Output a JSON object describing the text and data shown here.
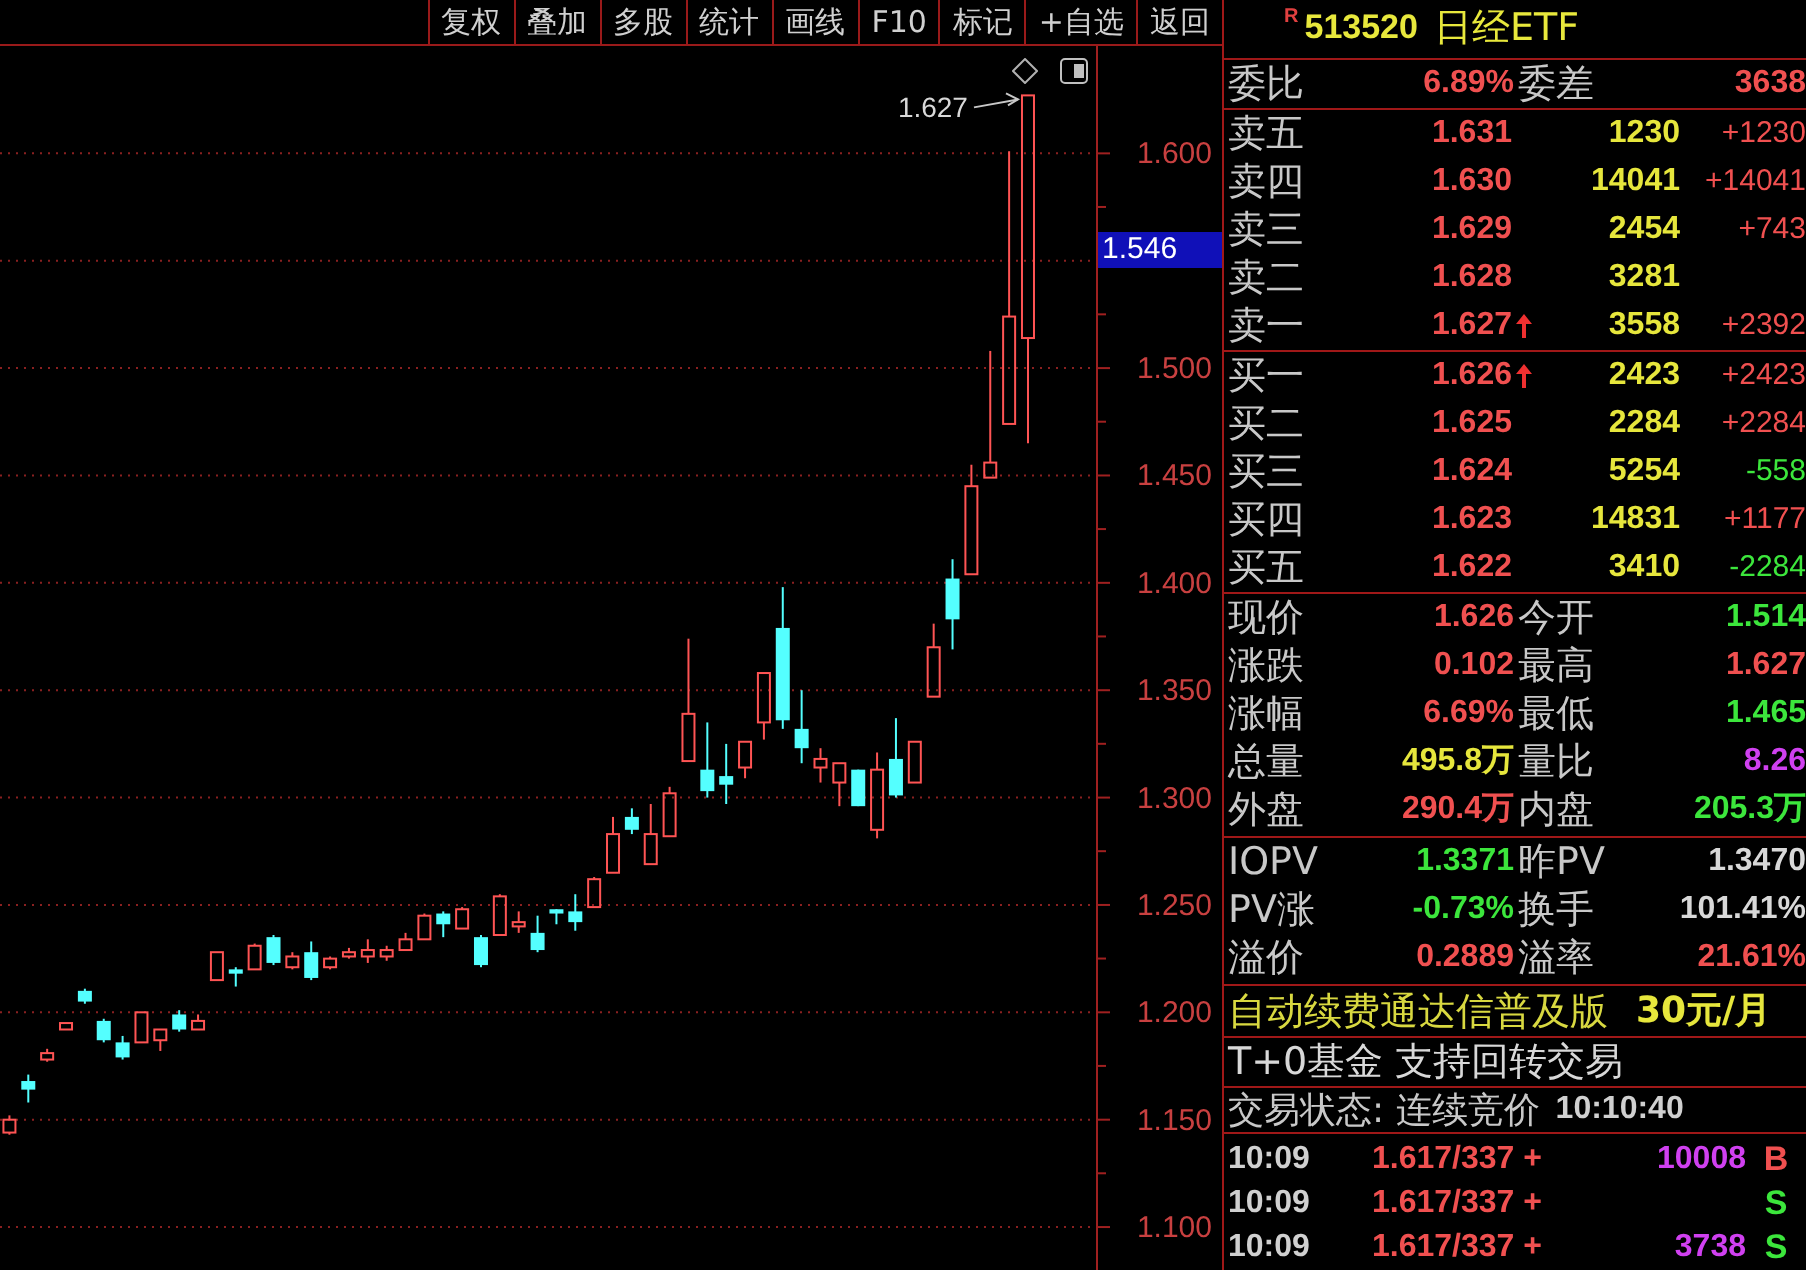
{
  "toolbar": {
    "buttons": [
      "复权",
      "叠加",
      "多股",
      "统计",
      "画线",
      "F10",
      "标记",
      "+自选",
      "返回"
    ]
  },
  "chart": {
    "price_tag": "1.546",
    "chart_data": {
      "type": "candlestick",
      "ohlc": [
        [
          1.144,
          1.152,
          1.143,
          1.15
        ],
        [
          1.168,
          1.171,
          1.158,
          1.164
        ],
        [
          1.178,
          1.183,
          1.177,
          1.181
        ],
        [
          1.192,
          1.195,
          1.192,
          1.195
        ],
        [
          1.21,
          1.211,
          1.204,
          1.205
        ],
        [
          1.196,
          1.197,
          1.186,
          1.187
        ],
        [
          1.186,
          1.189,
          1.178,
          1.179
        ],
        [
          1.186,
          1.2,
          1.186,
          1.2
        ],
        [
          1.187,
          1.192,
          1.182,
          1.192
        ],
        [
          1.199,
          1.201,
          1.191,
          1.192
        ],
        [
          1.192,
          1.199,
          1.192,
          1.196
        ],
        [
          1.215,
          1.228,
          1.215,
          1.228
        ],
        [
          1.22,
          1.221,
          1.212,
          1.218
        ],
        [
          1.22,
          1.232,
          1.22,
          1.231
        ],
        [
          1.235,
          1.236,
          1.222,
          1.223
        ],
        [
          1.221,
          1.228,
          1.22,
          1.226
        ],
        [
          1.228,
          1.233,
          1.215,
          1.216
        ],
        [
          1.221,
          1.226,
          1.22,
          1.225
        ],
        [
          1.226,
          1.23,
          1.225,
          1.228
        ],
        [
          1.226,
          1.234,
          1.223,
          1.229
        ],
        [
          1.226,
          1.231,
          1.224,
          1.229
        ],
        [
          1.229,
          1.237,
          1.229,
          1.234
        ],
        [
          1.234,
          1.246,
          1.234,
          1.245
        ],
        [
          1.246,
          1.247,
          1.235,
          1.241
        ],
        [
          1.239,
          1.249,
          1.239,
          1.248
        ],
        [
          1.235,
          1.236,
          1.221,
          1.222
        ],
        [
          1.236,
          1.255,
          1.236,
          1.254
        ],
        [
          1.24,
          1.247,
          1.237,
          1.242
        ],
        [
          1.237,
          1.245,
          1.228,
          1.229
        ],
        [
          1.248,
          1.248,
          1.241,
          1.246
        ],
        [
          1.247,
          1.255,
          1.238,
          1.242
        ],
        [
          1.249,
          1.263,
          1.249,
          1.262
        ],
        [
          1.265,
          1.291,
          1.265,
          1.283
        ],
        [
          1.291,
          1.295,
          1.283,
          1.285
        ],
        [
          1.269,
          1.297,
          1.269,
          1.283
        ],
        [
          1.282,
          1.305,
          1.282,
          1.302
        ],
        [
          1.317,
          1.374,
          1.317,
          1.339
        ],
        [
          1.313,
          1.335,
          1.3,
          1.303
        ],
        [
          1.31,
          1.325,
          1.297,
          1.306
        ],
        [
          1.314,
          1.326,
          1.309,
          1.326
        ],
        [
          1.335,
          1.358,
          1.327,
          1.358
        ],
        [
          1.379,
          1.398,
          1.332,
          1.336
        ],
        [
          1.332,
          1.35,
          1.316,
          1.323
        ],
        [
          1.314,
          1.323,
          1.307,
          1.318
        ],
        [
          1.307,
          1.316,
          1.296,
          1.316
        ],
        [
          1.313,
          1.313,
          1.296,
          1.296
        ],
        [
          1.285,
          1.321,
          1.281,
          1.313
        ],
        [
          1.318,
          1.337,
          1.3,
          1.301
        ],
        [
          1.307,
          1.326,
          1.307,
          1.326
        ],
        [
          1.347,
          1.381,
          1.347,
          1.37
        ],
        [
          1.402,
          1.411,
          1.369,
          1.383
        ],
        [
          1.404,
          1.455,
          1.404,
          1.445
        ],
        [
          1.449,
          1.508,
          1.449,
          1.456
        ],
        [
          1.474,
          1.601,
          1.474,
          1.524
        ],
        [
          1.514,
          1.627,
          1.465,
          1.627
        ],
        null,
        null,
        null
      ],
      "ylim": [
        1.08,
        1.65
      ],
      "yticks": [
        {
          "value": 1.6,
          "label": "1.600"
        },
        {
          "value": 1.5,
          "label": "1.500"
        },
        {
          "value": 1.45,
          "label": "1.450"
        },
        {
          "value": 1.4,
          "label": "1.400"
        },
        {
          "value": 1.35,
          "label": "1.350"
        },
        {
          "value": 1.3,
          "label": "1.300"
        },
        {
          "value": 1.25,
          "label": "1.250"
        },
        {
          "value": 1.2,
          "label": "1.200"
        },
        {
          "value": 1.15,
          "label": "1.150"
        },
        {
          "value": 1.1,
          "label": "1.100"
        }
      ],
      "grid": true,
      "annotations": [
        "1.627"
      ]
    }
  },
  "quote": {
    "flag": "R",
    "code": "513520",
    "name": "日经ETF"
  },
  "order_ratio": [
    {
      "label": "委比",
      "value": "6.89%",
      "color": "#f05050"
    },
    {
      "label": "委差",
      "value": "3638",
      "color": "#f05050"
    }
  ],
  "asks": [
    {
      "label": "卖五",
      "price": "1.631",
      "volume": "1230",
      "change": "+1230",
      "color": "#f05050",
      "uptick": false
    },
    {
      "label": "卖四",
      "price": "1.630",
      "volume": "14041",
      "change": "+14041",
      "color": "#f05050",
      "uptick": false
    },
    {
      "label": "卖三",
      "price": "1.629",
      "volume": "2454",
      "change": "+743",
      "color": "#f05050",
      "uptick": false
    },
    {
      "label": "卖二",
      "price": "1.628",
      "volume": "3281",
      "uptick": false
    },
    {
      "label": "卖一",
      "price": "1.627",
      "volume": "3558",
      "change": "+2392",
      "color": "#f05050",
      "uptick": true
    }
  ],
  "bids": [
    {
      "label": "买一",
      "price": "1.626",
      "volume": "2423",
      "change": "+2423",
      "color": "#f05050",
      "uptick": true
    },
    {
      "label": "买二",
      "price": "1.625",
      "volume": "2284",
      "change": "+2284",
      "color": "#f05050",
      "uptick": false
    },
    {
      "label": "买三",
      "price": "1.624",
      "volume": "5254",
      "change": "-558",
      "color": "#3ce63c",
      "uptick": false
    },
    {
      "label": "买四",
      "price": "1.623",
      "volume": "14831",
      "change": "+1177",
      "color": "#f05050",
      "uptick": false
    },
    {
      "label": "买五",
      "price": "1.622",
      "volume": "3410",
      "change": "-2284",
      "color": "#3ce63c",
      "uptick": false
    }
  ],
  "stats": [
    {
      "label": "现价",
      "value": "1.626",
      "color": "#f05050"
    },
    {
      "label": "今开",
      "value": "1.514",
      "color": "#3ce63c"
    },
    {
      "label": "涨跌",
      "value": "0.102",
      "color": "#f05050"
    },
    {
      "label": "最高",
      "value": "1.627",
      "color": "#f05050"
    },
    {
      "label": "涨幅",
      "value": "6.69%",
      "color": "#f05050"
    },
    {
      "label": "最低",
      "value": "1.465",
      "color": "#3ce63c"
    },
    {
      "label": "总量",
      "value": "495.8万",
      "color": "#e6e63c"
    },
    {
      "label": "量比",
      "value": "8.26",
      "color": "#d040f0"
    },
    {
      "label": "外盘",
      "value": "290.4万",
      "color": "#f05050"
    },
    {
      "label": "内盘",
      "value": "205.3万",
      "color": "#3ce63c"
    }
  ],
  "fund_stats": [
    {
      "label": "IOPV",
      "value": "1.3371",
      "color": "#3ce63c"
    },
    {
      "label": "昨PV",
      "value": "1.3470",
      "color": "#d8d8d8"
    },
    {
      "label": "PV涨",
      "value": "-0.73%",
      "color": "#3ce63c"
    },
    {
      "label": "换手",
      "value": "101.41%",
      "color": "#d8d8d8"
    },
    {
      "label": "溢价",
      "value": "0.2889",
      "color": "#f05050"
    },
    {
      "label": "溢率",
      "value": "21.61%",
      "color": "#f05050"
    }
  ],
  "promo": {
    "text": "自动续费通达信普及版",
    "price": "30元/月"
  },
  "notice": "T+0基金 支持回转交易",
  "trade_status": {
    "label": "交易状态: 连续竞价",
    "time": "10:10:40"
  },
  "ticks": [
    {
      "time": "10:09",
      "price": "1.617/337 +",
      "volume": "10008",
      "side": "B",
      "color": "#f05050"
    },
    {
      "time": "10:09",
      "price": "1.617/337 +",
      "side": "S",
      "color": "#3ce63c"
    },
    {
      "time": "10:09",
      "price": "1.617/337 +",
      "volume": "3738",
      "side": "S",
      "color": "#3ce63c"
    }
  ]
}
